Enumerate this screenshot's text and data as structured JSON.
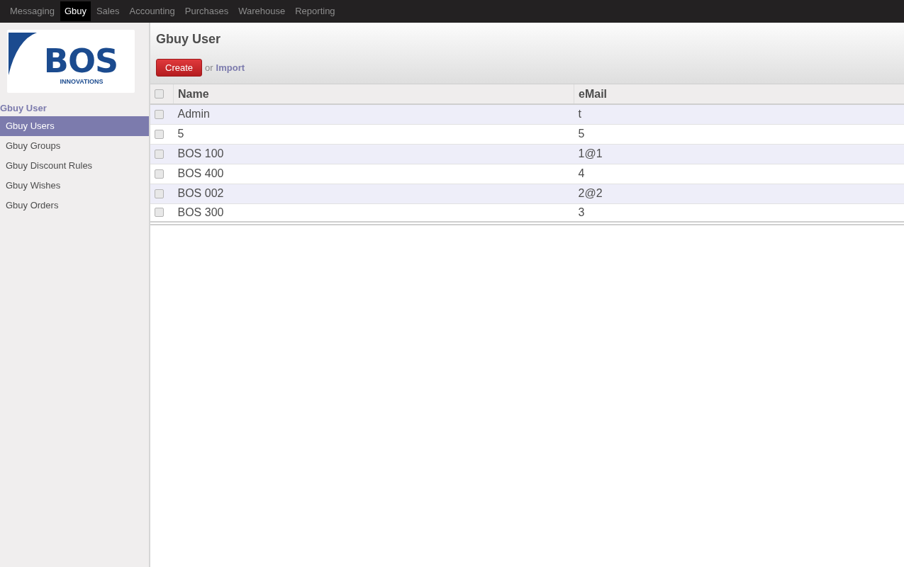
{
  "top_menu": [
    {
      "label": "Messaging",
      "selected": false
    },
    {
      "label": "Gbuy",
      "selected": true
    },
    {
      "label": "Sales",
      "selected": false
    },
    {
      "label": "Accounting",
      "selected": false
    },
    {
      "label": "Purchases",
      "selected": false
    },
    {
      "label": "Warehouse",
      "selected": false
    },
    {
      "label": "Reporting",
      "selected": false
    }
  ],
  "logo": {
    "name": "BOS",
    "tagline": "INNOVATIONS"
  },
  "sidebar": {
    "heading": "Gbuy User",
    "items": [
      {
        "label": "Gbuy Users",
        "selected": true
      },
      {
        "label": "Gbuy Groups",
        "selected": false
      },
      {
        "label": "Gbuy Discount Rules",
        "selected": false
      },
      {
        "label": "Gbuy Wishes",
        "selected": false
      },
      {
        "label": "Gbuy Orders",
        "selected": false
      }
    ]
  },
  "page": {
    "title": "Gbuy User",
    "create_button": "Create",
    "or_text": "or",
    "import_link": "Import"
  },
  "table": {
    "select_all_checked": false,
    "columns": [
      "Name",
      "eMail"
    ],
    "rows": [
      {
        "cells": [
          "Admin",
          "t"
        ],
        "checked": false
      },
      {
        "cells": [
          "5",
          "5"
        ],
        "checked": false
      },
      {
        "cells": [
          "BOS 100",
          "1@1"
        ],
        "checked": false
      },
      {
        "cells": [
          "BOS 400",
          "4"
        ],
        "checked": false
      },
      {
        "cells": [
          "BOS 002",
          "2@2"
        ],
        "checked": false
      },
      {
        "cells": [
          "BOS 300",
          "3"
        ],
        "checked": false
      }
    ]
  }
}
